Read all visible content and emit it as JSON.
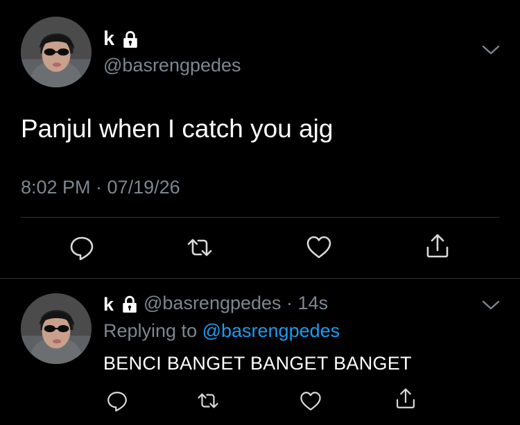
{
  "main_tweet": {
    "display_name": "k",
    "lock_icon": "lock-icon",
    "handle": "@basrengpedes",
    "text": "Panjul when I catch you ajg",
    "timestamp": "8:02 PM · 07/19/26",
    "actions": [
      "reply-icon",
      "retweet-icon",
      "like-icon",
      "share-icon"
    ]
  },
  "reply_tweet": {
    "display_name": "k",
    "lock_icon": "lock-icon",
    "handle_time": "@basrengpedes · 14s",
    "replying_prefix": "Replying to ",
    "replying_handle": "@basrengpedes",
    "text": "BENCI BANGET BANGET BANGET",
    "actions": [
      "reply-icon",
      "retweet-icon",
      "like-icon",
      "share-icon"
    ]
  },
  "colors": {
    "background": "#000000",
    "text": "#ffffff",
    "secondary_text": "#7d8790",
    "mention": "#1d9bf0",
    "divider": "#2f3336"
  }
}
